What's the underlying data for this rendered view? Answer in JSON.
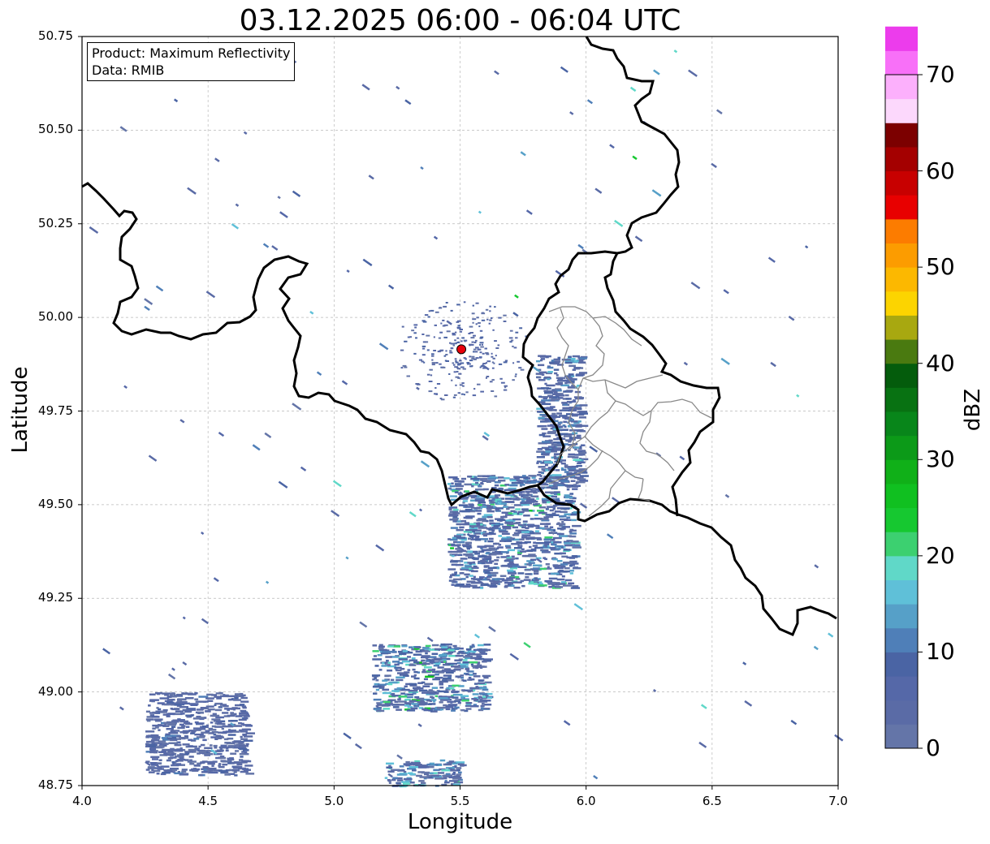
{
  "title": "03.12.2025 06:00 - 06:04 UTC",
  "info_box": {
    "product_line": "Product: Maximum Reflectivity",
    "data_line": "Data: RMIB"
  },
  "axes": {
    "xlabel": "Longitude",
    "ylabel": "Latitude",
    "xlim": [
      4.0,
      7.0
    ],
    "ylim": [
      48.75,
      50.75
    ],
    "x_ticks": [
      "4.0",
      "4.5",
      "5.0",
      "5.5",
      "6.0",
      "6.5",
      "7.0"
    ],
    "y_ticks": [
      "48.75",
      "49.00",
      "49.25",
      "49.50",
      "49.75",
      "50.00",
      "50.25",
      "50.50",
      "50.75"
    ],
    "grid": true
  },
  "colorbar": {
    "label": "dBZ",
    "ticks": [
      "0",
      "10",
      "20",
      "30",
      "40",
      "50",
      "60",
      "70"
    ],
    "range": [
      0,
      70
    ],
    "step": 2.5,
    "colors": [
      "#6475a8",
      "#5a6ba6",
      "#5568a8",
      "#4a64a4",
      "#4f7fb8",
      "#56a0c8",
      "#5fc0d8",
      "#60d8c8",
      "#3cd070",
      "#16c830",
      "#10c020",
      "#10b018",
      "#0c9a18",
      "#08861a",
      "#087212",
      "#045c0c",
      "#4a7a10",
      "#a8a810",
      "#fcd400",
      "#fcb800",
      "#fc9c00",
      "#fc7c00",
      "#e80000",
      "#c80000",
      "#a40000",
      "#7c0000",
      "#fcd8fc",
      "#fcb0fc",
      "#f870f8",
      "#ec3cec"
    ]
  },
  "chart_data": {
    "type": "map",
    "projection": "plate-carree",
    "radar_site": {
      "lon": 5.505,
      "lat": 49.915
    },
    "reflectivity_range_dbz": [
      0,
      70
    ],
    "precipitation_areas": [
      {
        "lon": [
          5.15,
          5.6
        ],
        "lat": [
          48.95,
          49.13
        ],
        "max_dbz": 25
      },
      {
        "lon": [
          5.2,
          5.5
        ],
        "lat": [
          48.75,
          48.82
        ],
        "max_dbz": 25
      },
      {
        "lon": [
          4.25,
          4.65
        ],
        "lat": [
          48.78,
          49.0
        ],
        "max_dbz": 10
      },
      {
        "lon": [
          5.45,
          5.95
        ],
        "lat": [
          49.28,
          49.58
        ],
        "max_dbz": 22
      },
      {
        "lon": [
          5.8,
          5.98
        ],
        "lat": [
          49.55,
          49.9
        ],
        "max_dbz": 18
      }
    ]
  }
}
